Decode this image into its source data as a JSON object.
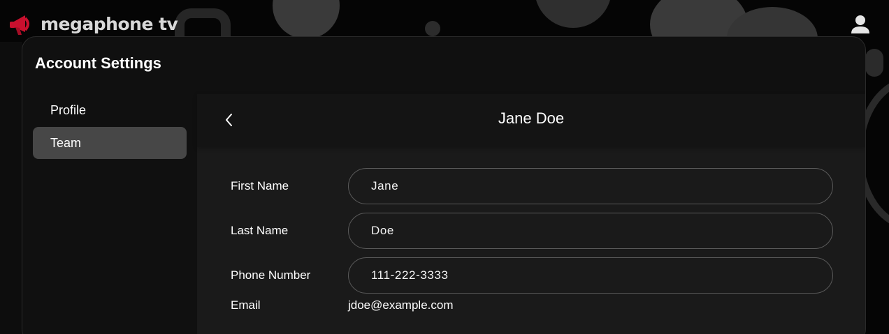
{
  "app": {
    "logo_text": "megaphone tv",
    "brand_color": "#c8102e"
  },
  "header": {
    "user_icon": "user-icon"
  },
  "panel": {
    "title": "Account Settings"
  },
  "sidebar": {
    "items": [
      {
        "label": "Profile",
        "active": false
      },
      {
        "label": "Team",
        "active": true
      }
    ]
  },
  "detail": {
    "title": "Jane Doe",
    "back_icon": "chevron-left-icon",
    "fields": {
      "first_name": {
        "label": "First Name",
        "value": "Jane"
      },
      "last_name": {
        "label": "Last Name",
        "value": "Doe"
      },
      "phone": {
        "label": "Phone Number",
        "value": "111-222-3333"
      },
      "email": {
        "label": "Email",
        "value": "jdoe@example.com"
      }
    }
  }
}
